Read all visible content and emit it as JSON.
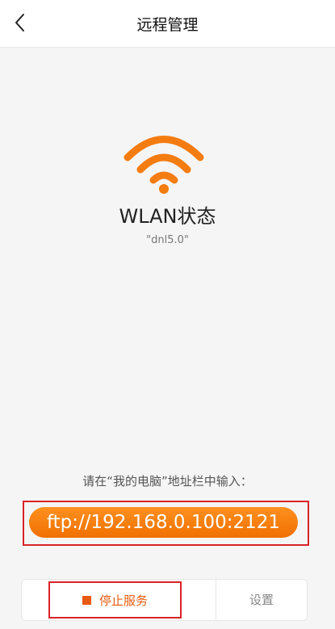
{
  "header": {
    "title": "远程管理",
    "back_icon": "chevron-left-icon"
  },
  "status": {
    "icon": "wifi-icon",
    "title": "WLAN状态",
    "ssid": "\"dnl5.0\""
  },
  "instruction": {
    "text": "请在“我的电脑”地址栏中输入："
  },
  "ftp": {
    "address": "ftp://192.168.0.100:2121"
  },
  "actions": {
    "stop_label": "停止服务",
    "stop_icon": "stop-square-icon",
    "settings_label": "设置"
  },
  "colors": {
    "accent": "#f07000",
    "highlight": "#d9232a",
    "stop": "#e85a10"
  }
}
